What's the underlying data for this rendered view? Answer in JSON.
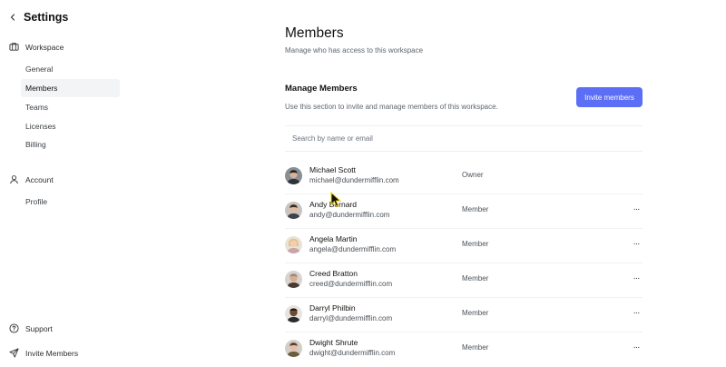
{
  "sidebar": {
    "title": "Settings",
    "workspace": {
      "label": "Workspace",
      "items": [
        "General",
        "Members",
        "Teams",
        "Licenses",
        "Billing"
      ]
    },
    "account": {
      "label": "Account",
      "items": [
        "Profile"
      ]
    },
    "footer": {
      "support": "Support",
      "invite": "Invite Members"
    }
  },
  "main": {
    "title": "Members",
    "subtitle": "Manage who has access to this workspace",
    "section_title": "Manage Members",
    "section_desc": "Use this section to invite and manage members of this workspace.",
    "invite_button": "Invite members",
    "search_placeholder": "Search by name or email",
    "members": [
      {
        "name": "Michael Scott",
        "email": "michael@dundermifflin.com",
        "role": "Owner",
        "more": ""
      },
      {
        "name": "Andy Bernard",
        "email": "andy@dundermifflin.com",
        "role": "Member",
        "more": "···"
      },
      {
        "name": "Angela Martin",
        "email": "angela@dundermifflin.com",
        "role": "Member",
        "more": "···"
      },
      {
        "name": "Creed Bratton",
        "email": "creed@dundermifflin.com",
        "role": "Member",
        "more": "···"
      },
      {
        "name": "Darryl Philbin",
        "email": "darryl@dundermifflin.com",
        "role": "Member",
        "more": "···"
      },
      {
        "name": "Dwight Shrute",
        "email": "dwight@dundermifflin.com",
        "role": "Member",
        "more": "···"
      }
    ]
  },
  "colors": {
    "accent": "#5b6ef5",
    "active_nav_bg": "#f3f4f6"
  },
  "icons": {
    "back": "chevron-left-icon",
    "workspace": "building-icon",
    "account": "user-icon",
    "support": "help-circle-icon",
    "invite": "send-icon",
    "more": "more-horizontal-icon"
  }
}
